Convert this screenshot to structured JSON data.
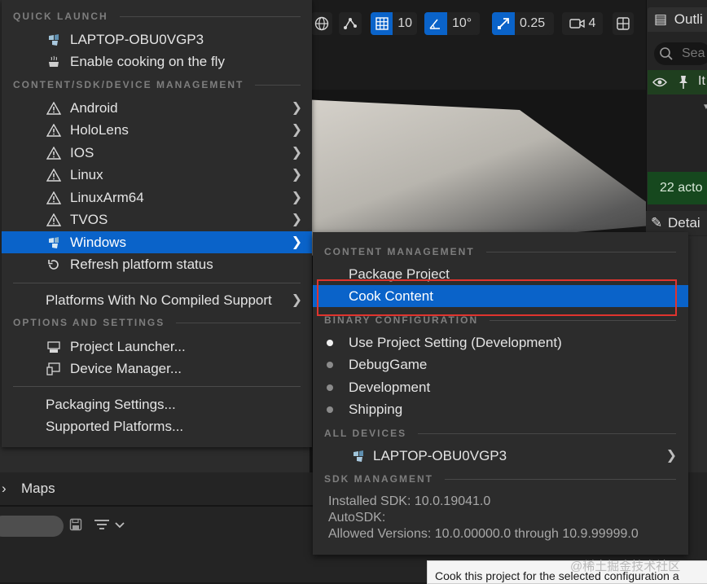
{
  "viewport": {
    "toolbar": {
      "grid_snap_value": "10",
      "rotation_snap_value": "10°",
      "scale_snap_value": "0.25",
      "camera_speed_value": "4"
    }
  },
  "outliner": {
    "tab_label": "Outli",
    "search_placeholder": "Sea",
    "header_label": "It",
    "actor_count": "22 acto",
    "details_tab_label": "Detai"
  },
  "content_browser": {
    "maps_label": "Maps"
  },
  "platforms_menu": {
    "quick_launch": {
      "header": "QUICK LAUNCH",
      "device_label": "LAPTOP-OBU0VGP3",
      "cook_on_fly_label": "Enable cooking on the fly"
    },
    "content_management": {
      "header": "CONTENT/SDK/DEVICE MANAGEMENT",
      "platforms": [
        {
          "label": "Android",
          "icon": "warning-icon"
        },
        {
          "label": "HoloLens",
          "icon": "warning-icon"
        },
        {
          "label": "IOS",
          "icon": "warning-icon"
        },
        {
          "label": "Linux",
          "icon": "warning-icon"
        },
        {
          "label": "LinuxArm64",
          "icon": "warning-icon"
        },
        {
          "label": "TVOS",
          "icon": "warning-icon"
        },
        {
          "label": "Windows",
          "icon": "windows-platform-icon"
        }
      ],
      "refresh_label": "Refresh platform status"
    },
    "no_compiled_support_label": "Platforms With No Compiled Support",
    "options": {
      "header": "OPTIONS AND SETTINGS",
      "project_launcher_label": "Project Launcher...",
      "device_manager_label": "Device Manager..."
    },
    "packaging_settings_label": "Packaging Settings...",
    "supported_platforms_label": "Supported Platforms..."
  },
  "windows_submenu": {
    "content_management_header": "CONTENT MANAGEMENT",
    "package_project_label": "Package Project",
    "cook_content_label": "Cook Content",
    "binary_config_header": "BINARY CONFIGURATION",
    "binary_configs": [
      {
        "label": "Use Project Setting (Development)",
        "selected": true
      },
      {
        "label": "DebugGame",
        "selected": false
      },
      {
        "label": "Development",
        "selected": false
      },
      {
        "label": "Shipping",
        "selected": false
      }
    ],
    "all_devices_header": "ALL DEVICES",
    "device_label": "LAPTOP-OBU0VGP3",
    "sdk_header": "SDK MANAGMENT",
    "installed_sdk": "Installed SDK: 10.0.19041.0",
    "auto_sdk": "AutoSDK:",
    "allowed_versions": "Allowed Versions: 10.0.00000.0 through 10.9.99999.0"
  },
  "tooltip": {
    "text": "Cook this project for the selected configuration a"
  },
  "watermark": "@稀土掘金技术社区",
  "colors": {
    "menu_bg": "#2c2c2c",
    "selection": "#0a63c9",
    "highlight_box": "#e0342e",
    "green_header": "#16481e"
  }
}
